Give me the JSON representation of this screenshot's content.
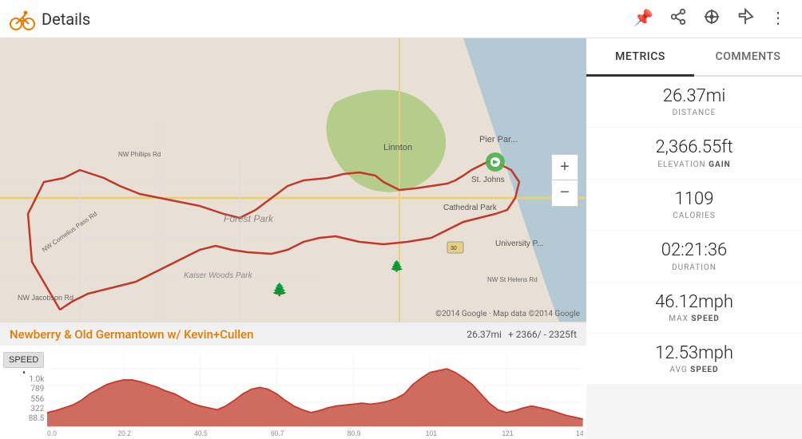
{
  "header": {
    "title": "Details",
    "icon_label": "cycling-icon",
    "actions": [
      "pin-icon",
      "share-icon",
      "location-icon",
      "directions-icon",
      "more-icon"
    ]
  },
  "tabs": {
    "metrics_label": "Metrics",
    "comments_label": "Comments",
    "active": "metrics"
  },
  "metrics": [
    {
      "value": "26.37mi",
      "label": "DISTANCE",
      "bold": ""
    },
    {
      "value": "2,366.55ft",
      "label": "ELEVATION ",
      "bold": "GAIN"
    },
    {
      "value": "1109",
      "label": "CALORIES",
      "bold": ""
    },
    {
      "value": "02:21:36",
      "label": "DURATION",
      "bold": ""
    },
    {
      "value": "46.12mph",
      "label": "MAX ",
      "bold": "SPEED"
    },
    {
      "value": "12.53mph",
      "label": "AVG ",
      "bold": "SPEED"
    }
  ],
  "activity": {
    "title": "Newberry & Old Germantown w/ Kevin+Cullen",
    "distance": "26.37mi",
    "elevation_gain": "+ 2366",
    "elevation_loss": "/ - 2325ft"
  },
  "chart": {
    "speed_label": "SPEED",
    "y_labels": [
      "1.0k",
      "789",
      "556",
      "322",
      "88.5"
    ],
    "x_labels": [
      "0.0",
      "20.2",
      "40.5",
      "60.7",
      "80.9",
      "101",
      "121",
      "14"
    ]
  },
  "map": {
    "copyright": "©2014 Google · Map data ©2014 Google"
  },
  "map_controls": {
    "zoom_in": "+",
    "zoom_out": "−"
  }
}
